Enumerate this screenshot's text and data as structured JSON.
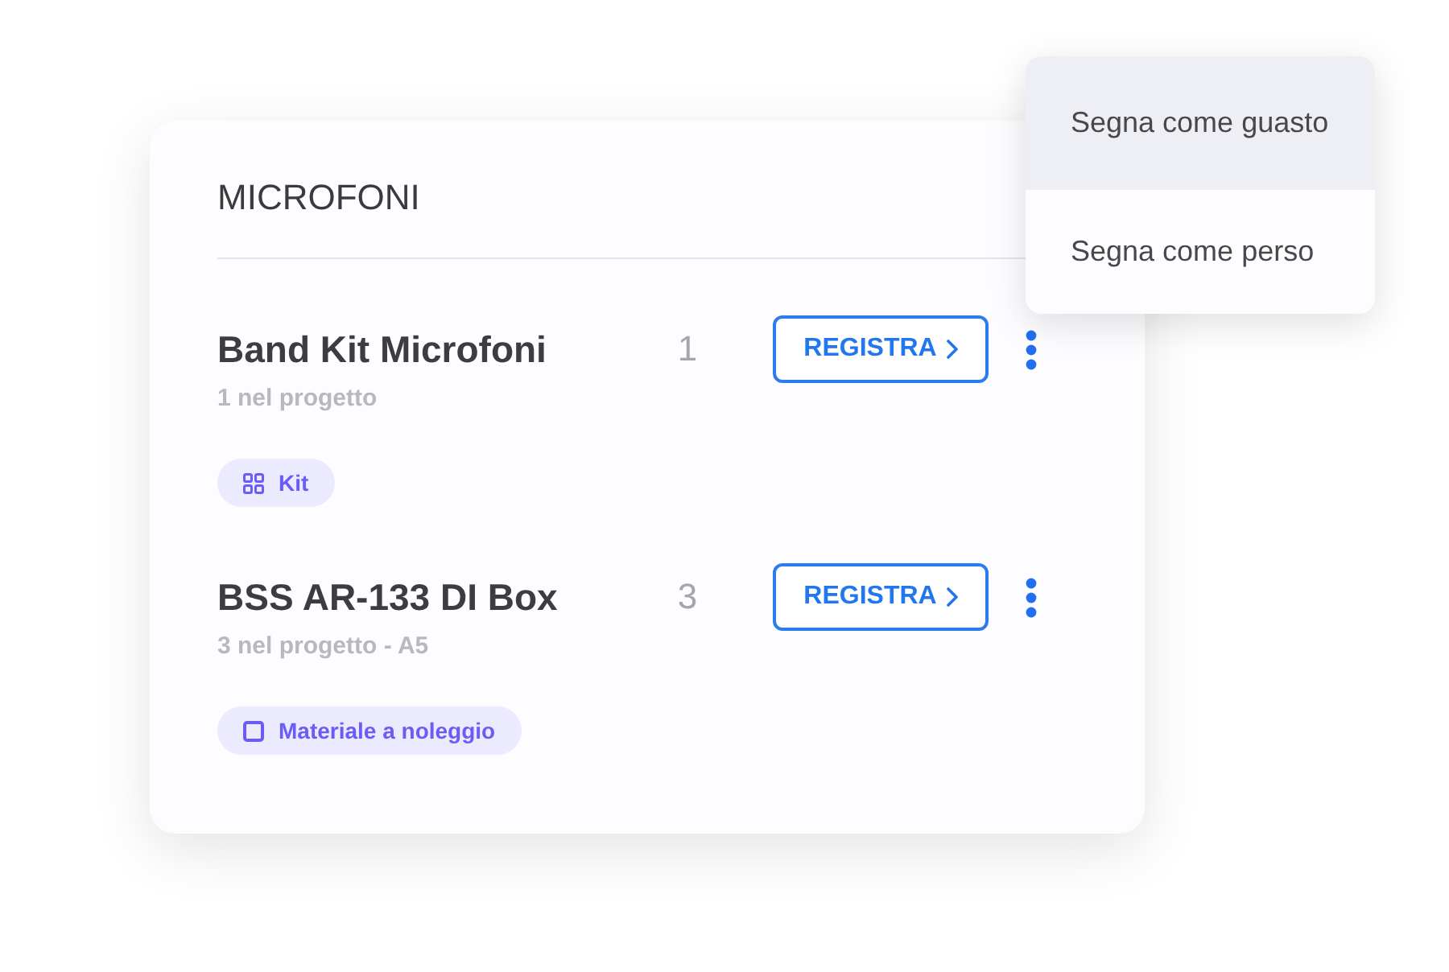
{
  "section": {
    "title": "MICROFONI"
  },
  "items": [
    {
      "name": "Band Kit Microfoni",
      "subtitle": "1 nel progetto",
      "quantity": "1",
      "button": "REGISTRA",
      "tag": {
        "kind": "kit",
        "label": "Kit"
      }
    },
    {
      "name": "BSS AR-133 DI Box",
      "subtitle": "3 nel progetto - A5",
      "quantity": "3",
      "button": "REGISTRA",
      "tag": {
        "kind": "rental",
        "label": "Materiale a noleggio"
      }
    }
  ],
  "menu": {
    "items": [
      {
        "label": "Segna come guasto",
        "highlighted": true
      },
      {
        "label": "Segna come perso",
        "highlighted": false
      }
    ]
  }
}
